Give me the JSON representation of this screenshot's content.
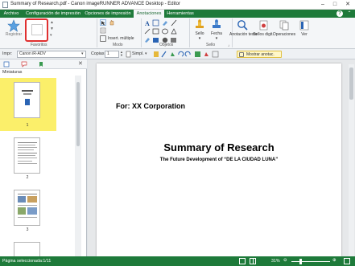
{
  "window": {
    "title": "Summary of Research.pdf - Canon imageRUNNER ADVANCE Desktop - Editor"
  },
  "menu": {
    "tabs": [
      "Archivo",
      "Configuración de impresión",
      "Opciones de impresión",
      "Anotaciones",
      "Herramientas"
    ],
    "active": "Anotaciones"
  },
  "ribbon": {
    "registrar": "Registrar",
    "groups": {
      "favoritos": "Favoritos",
      "modo": "Modo",
      "objetos": "Objetos",
      "sello": "Sello"
    },
    "insert_multiple": "Insert. múltiple",
    "sello": "Sello",
    "fecha": "Fecha",
    "anotacion_texto": "Anotación texto",
    "sellos_digit": "Sellos digit.",
    "operaciones": "Operaciones",
    "ver": "Ver"
  },
  "toolbar": {
    "impr_label": "Impr:",
    "printer": "Canon iR-ADV",
    "copias_label": "Copias:",
    "copias_value": "1",
    "simple": "Simpl.",
    "mostrar_anotac": "Mostrar anotac."
  },
  "left_panel": {
    "section": "Miniaturas",
    "pages": [
      "1",
      "2",
      "3"
    ]
  },
  "document": {
    "for_line": "For: XX Corporation",
    "title": "Summary of Research",
    "subtitle": "The Future Development of “DE LA CIUDAD LUNA”"
  },
  "status": {
    "page_info": "Página seleccionada:1/11",
    "zoom": "31%"
  },
  "colors": {
    "accent_green": "#1e7a3a",
    "selection_yellow": "#fbef6a",
    "highlight_red": "#e03030"
  }
}
